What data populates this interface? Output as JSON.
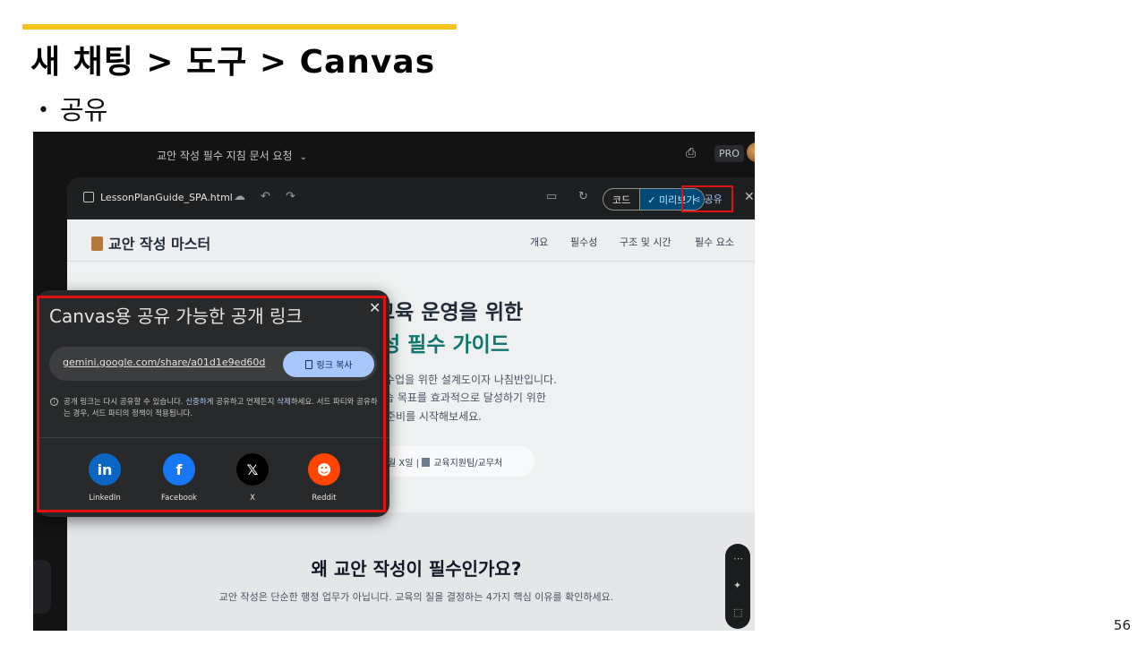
{
  "slide": {
    "title": "새 채팅 > 도구 > Canvas",
    "bullet": "공유",
    "page_number": "56"
  },
  "topbar": {
    "chat_title": "교안 작성 필수 지침 문서 요청",
    "pro_badge": "PRO"
  },
  "canvas": {
    "file_name": "LessonPlanGuide_SPA.html",
    "code_tab": "코드",
    "preview_tab": "미리보기",
    "share_label": "공유"
  },
  "site": {
    "logo": "교안 작성 마스터",
    "nav": [
      "개요",
      "필수성",
      "구조 및 시간",
      "필수 요소"
    ],
    "hero_line1": "교육 운영을 위한",
    "hero_line2": "성 필수 가이드",
    "hero_p1": "수업을 위한 설계도이자 나침반입니다.",
    "hero_p2": "습 목표를 효과적으로 달성하기 위한",
    "hero_p3": "준비를 시작해보세요.",
    "pill_date": "월 X일",
    "pill_sep": "|",
    "pill_org": "교육지원팀/교무처",
    "why_title": "왜 교안 작성이 필수인가요?",
    "why_sub": "교안 작성은 단순한 행정 업무가 아닙니다. 교육의 질을 결정하는 4가지 핵심 이유를 확인하세요."
  },
  "share_dialog": {
    "title": "Canvas용 공유 가능한 공개 링크",
    "url": "gemini.google.com/share/a01d1e9ed60d",
    "copy_button": "링크 복사",
    "notice_part1": "공개 링크는 다시 공유할 수 있습니다. ",
    "notice_link1": "신중하게",
    "notice_part2": " 공유하고 언제든지 ",
    "notice_link2": "삭제",
    "notice_part3": "하세요. 서드 파티와 공유하는 경우, 서드 파티의 정책이 적용됩니다.",
    "socials": [
      {
        "label": "LinkedIn",
        "glyph": "in",
        "color": "#0a66c2",
        "icon": "linkedin-icon"
      },
      {
        "label": "Facebook",
        "glyph": "f",
        "color": "#1877f2",
        "icon": "facebook-icon"
      },
      {
        "label": "X",
        "glyph": "𝕏",
        "color": "#000000",
        "icon": "x-icon"
      },
      {
        "label": "Reddit",
        "glyph": "☻",
        "color": "#ff4500",
        "icon": "reddit-icon"
      }
    ]
  },
  "colors": {
    "accent_bar": "#f6c41a",
    "highlight_box": "#e0120f",
    "hero_green": "#0f766e"
  }
}
